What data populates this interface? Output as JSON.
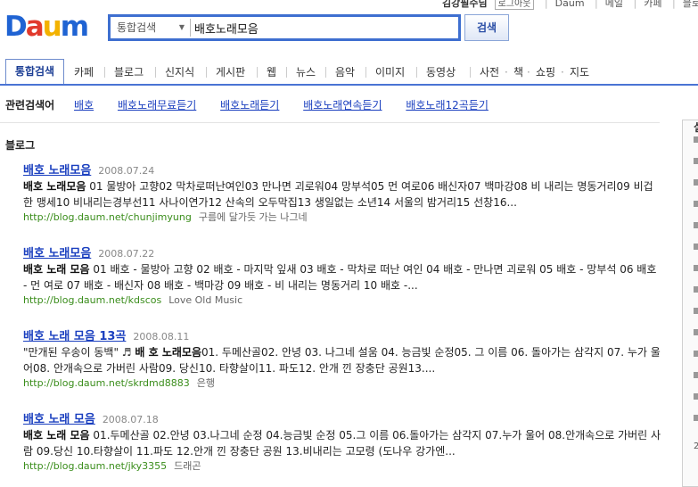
{
  "top_links": {
    "user": "김강필수님",
    "logout": "로그아웃",
    "daum": "Daum",
    "mail": "메일",
    "cafe": "카페",
    "blog": "블로그"
  },
  "logo": {
    "d": "D",
    "a": "a",
    "u": "u",
    "m": "m",
    "alt": "Daum"
  },
  "search": {
    "category": "통합검색",
    "query": "배호노래모음",
    "button": "검색"
  },
  "tabs": [
    "통합검색",
    "카페",
    "블로그",
    "신지식",
    "게시판",
    "웹",
    "뉴스",
    "음악",
    "이미지",
    "동영상",
    "사전",
    "책",
    "쇼핑",
    "지도"
  ],
  "related": {
    "label": "관련검색어",
    "items": [
      "배호",
      "배호노래무료듣기",
      "배호노래듣기",
      "배호노래연속듣기",
      "배호노래12곡듣기"
    ]
  },
  "section_title": "블로그",
  "results": [
    {
      "title": "배호 노래모음",
      "date": "2008.07.24",
      "desc_bold": "배호 노래모음",
      "desc": " 01 물방아 고향02 막차로떠난여인03 만나면 괴로워04 망부석05 먼 여로06 배신자07 백마강08 비 내리는 명동거리09 비겁한 맹세10 비내리는경부선11 사나이연가12 산속의 오두막집13 생일없는 소년14 서울의 밤거리15 선창16...",
      "url": "http://blog.daum.net/chunjimyung",
      "author": "구름에 달가듯 가는 나그네"
    },
    {
      "title": "배호 노래모음",
      "date": "2008.07.22",
      "desc_bold": "배호 노래 모음",
      "desc": " 01 배호 - 물방아 고향 02 배호 - 마지막 잎새 03 배호 - 막차로 떠난 여인 04 배호 - 만나면 괴로워 05 배호 - 망부석 06 배호 - 먼 여로 07 배호 - 배신자 08 배호 - 백마강 09 배호 - 비 내리는 명동거리 10 배호 -...",
      "url": "http://blog.daum.net/kdscos",
      "author": "Love Old Music"
    },
    {
      "title": "배호 노래 모음 13곡",
      "date": "2008.08.11",
      "desc_pre": "\"만개된 우송이 동백\" ♬ ",
      "desc_bold": "배 호 노래모음",
      "desc": "01. 두메산골02. 안녕 03. 나그네 설움 04. 능금빛 순정05. 그 이름 06. 돌아가는 삼각지 07. 누가 울어08. 안개속으로 가버린 사람09. 당신10. 타향살이11. 파도12. 안개 낀 장충단 공원13....",
      "url": "http://blog.daum.net/skrdmd8883",
      "author": "은행"
    },
    {
      "title": "배호 노래 모음",
      "date": "2008.07.18",
      "desc_bold": "배호 노래 모음",
      "desc": " 01.두메산골 02.안녕 03.나그네 순정 04.능금빛 순정 05.그 이름 06.돌아가는 삼각지 07.누가 울어 08.안개속으로 가버린 사람 09.당신 10.타향살이 11.파도 12.안개 낀 장충단 공원 13.비내리는 고모령 (도나우 강가엔...",
      "url": "http://blog.daum.net/jky3355",
      "author": "드래곤"
    }
  ],
  "right_panel": {
    "header": "실",
    "page_num": "2"
  },
  "colors": {
    "accent": "#3e6fd0",
    "link": "#1a3fbf",
    "url": "#3a8d1b"
  }
}
